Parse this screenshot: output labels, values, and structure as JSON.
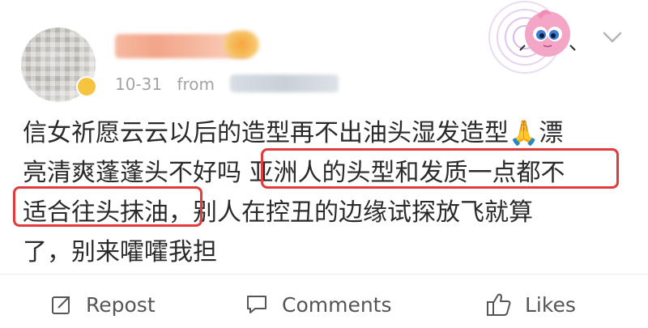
{
  "post": {
    "time": "10-31",
    "from_label": "from",
    "content_line1": "信女祈愿云云以后的造型再不出油头湿发造型🙏漂",
    "content_line2": "亮清爽蓬蓬头不好吗 亚洲人的头型和发质一点都不",
    "content_line3": "适合往头抹油，别人在控丑的边缘试探放飞就算",
    "content_line4": "了，别来嚯嚯我担"
  },
  "actions": {
    "repost": "Repost",
    "comments": "Comments",
    "likes": "Likes"
  },
  "colors": {
    "highlight": "#e23b3b",
    "meta": "#a3a3a3",
    "text": "#2a2a2a"
  }
}
